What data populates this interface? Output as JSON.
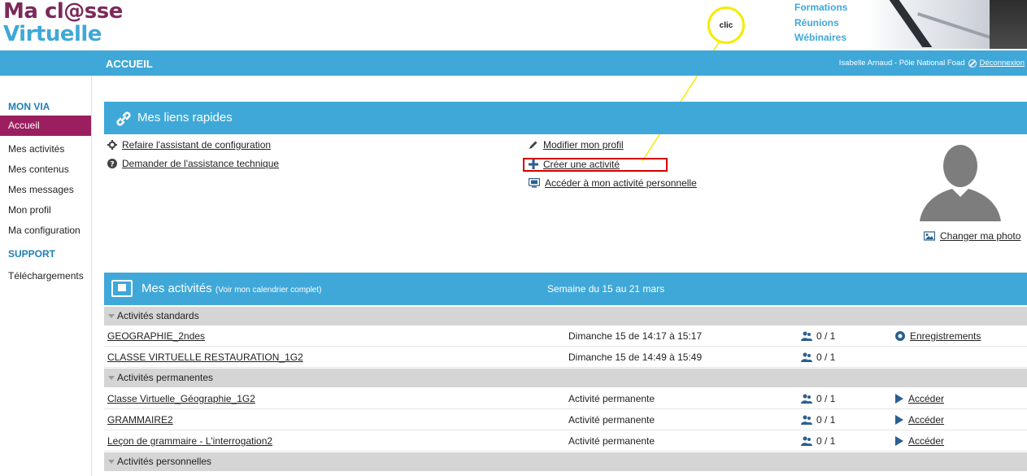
{
  "logo": {
    "line1": "Ma cl@sse",
    "line2": "Virtuelle"
  },
  "banner": {
    "links": [
      "Formations",
      "Réunions",
      "Wébinaires"
    ]
  },
  "annotation": {
    "clic": "clic"
  },
  "topbar": {
    "title": "ACCUEIL",
    "user": "Isabelle Arnaud - Pôle National Foad",
    "logout": "Déconnexion"
  },
  "sidebar": {
    "section1": "MON VIA",
    "items": [
      "Accueil",
      "Mes activités",
      "Mes contenus",
      "Mes messages",
      "Mon profil",
      "Ma configuration"
    ],
    "section2": "SUPPORT",
    "support_items": [
      "Téléchargements"
    ]
  },
  "quick": {
    "title": "Mes liens rapides",
    "left_links": [
      "Refaire l'assistant de configuration",
      "Demander de l'assistance technique"
    ],
    "right_links": [
      "Modifier mon profil",
      "Créer une activité",
      "Accéder à mon activité personnelle"
    ],
    "change_photo": "Changer ma photo"
  },
  "activities": {
    "title": "Mes activités",
    "calendar_link": "(Voir mon calendrier complet)",
    "week": "Semaine du 15 au 21 mars",
    "groups": [
      {
        "name": "Activités standards",
        "rows": [
          {
            "name": "GEOGRAPHIE_2ndes",
            "when": "Dimanche 15 de 14:17 à 15:17",
            "count": "0 / 1",
            "action": "Enregistrements"
          },
          {
            "name": "CLASSE VIRTUELLE RESTAURATION_1G2",
            "when": "Dimanche 15 de 14:49 à 15:49",
            "count": "0 / 1",
            "action": ""
          }
        ]
      },
      {
        "name": "Activités permanentes",
        "rows": [
          {
            "name": "Classe Virtuelle_Géographie_1G2",
            "when": "Activité permanente",
            "count": "0 / 1",
            "action": "Accéder"
          },
          {
            "name": "GRAMMAIRE2",
            "when": "Activité permanente",
            "count": "0 / 1",
            "action": "Accéder"
          },
          {
            "name": "Leçon de grammaire - L'interrogation2",
            "when": "Activité permanente",
            "count": "0 / 1",
            "action": "Accéder"
          }
        ]
      },
      {
        "name": "Activités personnelles",
        "rows": []
      }
    ]
  },
  "colors": {
    "accent_blue": "#3fa8d8",
    "sidebar_active": "#9b1f5f",
    "highlight_box": "#d40000",
    "annotation_yellow": "#f5ec00"
  }
}
